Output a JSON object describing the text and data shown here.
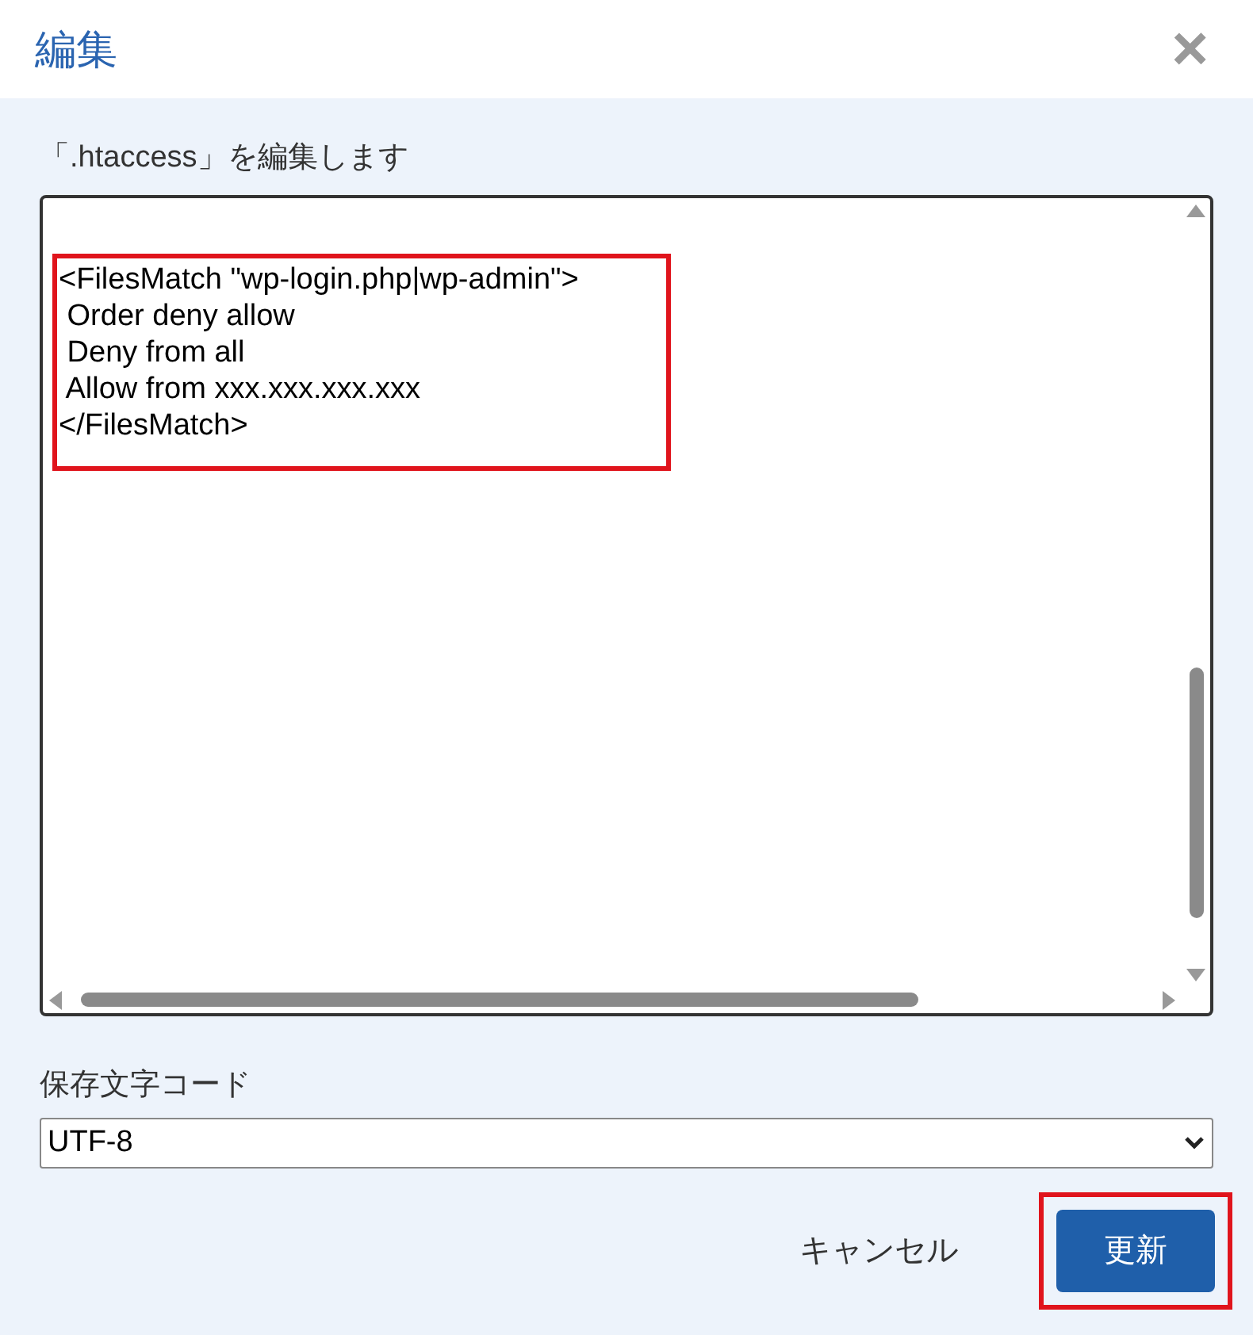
{
  "dialog": {
    "title": "編集",
    "close_glyph": "×"
  },
  "editor": {
    "label": "「.htaccess」を編集します",
    "highlighted": true,
    "lines": [
      "<FilesMatch \"wp-login.php|wp-admin\">",
      " Order deny allow",
      " Deny from all",
      " Allow from xxx.xxx.xxx.xxx",
      "</FilesMatch>"
    ]
  },
  "encoding": {
    "label": "保存文字コード",
    "value": "UTF-8"
  },
  "buttons": [
    {
      "label": "キャンセル",
      "kind": "text",
      "highlighted": false
    },
    {
      "label": "更新",
      "kind": "primary",
      "highlighted": true
    }
  ]
}
